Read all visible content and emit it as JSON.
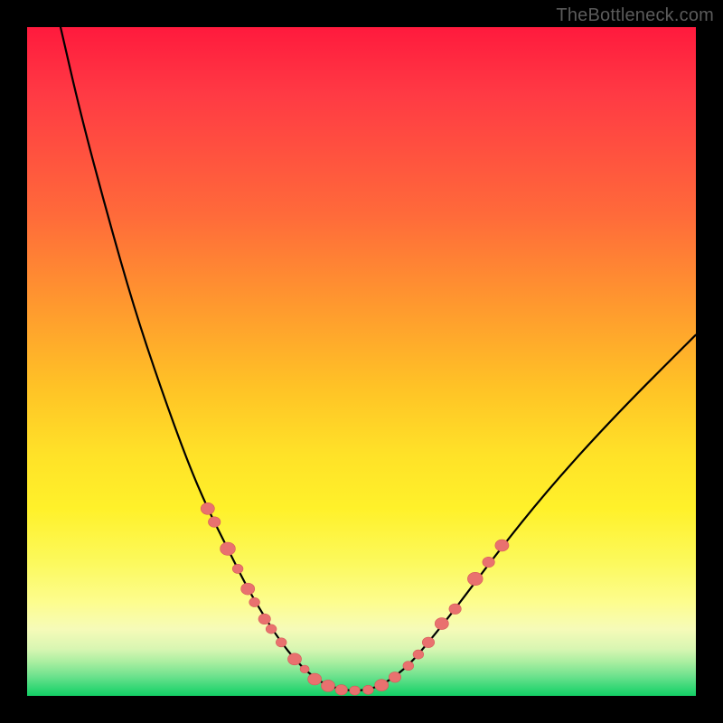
{
  "watermark": "TheBottleneck.com",
  "colors": {
    "frame": "#000000",
    "curve": "#000000",
    "marker_fill": "#e9716f",
    "marker_stroke": "#d55a58",
    "gradient_stops": [
      "#ff1a3d",
      "#ff3a44",
      "#ff6a3a",
      "#ff9a2e",
      "#ffc326",
      "#ffe228",
      "#fff12a",
      "#fcf95c",
      "#fdfd8e",
      "#f6fbb8",
      "#d8f6b2",
      "#a8eea0",
      "#6fe28e",
      "#2fd673",
      "#13cf65"
    ]
  },
  "chart_data": {
    "type": "line",
    "title": "",
    "xlabel": "",
    "ylabel": "",
    "xlim": [
      0,
      100
    ],
    "ylim": [
      0,
      100
    ],
    "grid": false,
    "series": [
      {
        "name": "bottleneck-curve",
        "x": [
          5,
          8,
          12,
          16,
          20,
          24,
          27,
          30,
          33,
          36,
          38,
          40,
          42,
          44,
          46,
          48,
          50,
          52,
          54,
          57,
          60,
          64,
          70,
          78,
          88,
          100
        ],
        "y": [
          100,
          87,
          72,
          58,
          46,
          35,
          28,
          22,
          16,
          11,
          8,
          5.5,
          3.5,
          2,
          1.2,
          0.8,
          0.8,
          1.2,
          2.2,
          4.5,
          8,
          13,
          21,
          31,
          42,
          54
        ]
      }
    ],
    "markers": {
      "name": "highlight-points",
      "points": [
        {
          "x": 27.0,
          "y": 28.0,
          "r": 1.2
        },
        {
          "x": 28.0,
          "y": 26.0,
          "r": 1.1
        },
        {
          "x": 30.0,
          "y": 22.0,
          "r": 1.3
        },
        {
          "x": 31.5,
          "y": 19.0,
          "r": 1.0
        },
        {
          "x": 33.0,
          "y": 16.0,
          "r": 1.2
        },
        {
          "x": 34.0,
          "y": 14.0,
          "r": 1.0
        },
        {
          "x": 35.5,
          "y": 11.5,
          "r": 1.1
        },
        {
          "x": 36.5,
          "y": 10.0,
          "r": 1.0
        },
        {
          "x": 38.0,
          "y": 8.0,
          "r": 1.0
        },
        {
          "x": 40.0,
          "y": 5.5,
          "r": 1.2
        },
        {
          "x": 41.5,
          "y": 4.0,
          "r": 0.9
        },
        {
          "x": 43.0,
          "y": 2.5,
          "r": 1.2
        },
        {
          "x": 45.0,
          "y": 1.5,
          "r": 1.2
        },
        {
          "x": 47.0,
          "y": 0.9,
          "r": 1.1
        },
        {
          "x": 49.0,
          "y": 0.8,
          "r": 1.0
        },
        {
          "x": 51.0,
          "y": 0.9,
          "r": 1.0
        },
        {
          "x": 53.0,
          "y": 1.6,
          "r": 1.2
        },
        {
          "x": 55.0,
          "y": 2.8,
          "r": 1.1
        },
        {
          "x": 57.0,
          "y": 4.5,
          "r": 1.0
        },
        {
          "x": 58.5,
          "y": 6.2,
          "r": 1.0
        },
        {
          "x": 60.0,
          "y": 8.0,
          "r": 1.1
        },
        {
          "x": 62.0,
          "y": 10.8,
          "r": 1.2
        },
        {
          "x": 64.0,
          "y": 13.0,
          "r": 1.1
        },
        {
          "x": 67.0,
          "y": 17.5,
          "r": 1.3
        },
        {
          "x": 69.0,
          "y": 20.0,
          "r": 1.1
        },
        {
          "x": 71.0,
          "y": 22.5,
          "r": 1.2
        }
      ]
    }
  }
}
